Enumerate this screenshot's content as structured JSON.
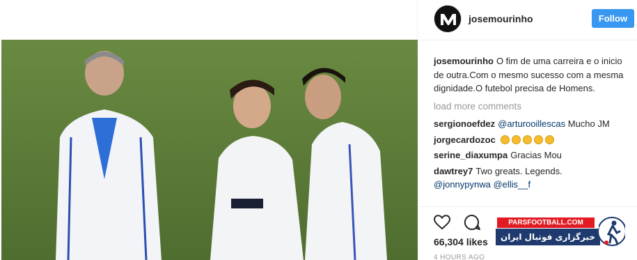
{
  "post": {
    "username": "josemourinho",
    "follow_label": "Follow",
    "caption_username": "josemourinho",
    "caption_text": "O fim de uma carreira e o inicio de outra.Com o mesmo sucesso com a mesma dignidade.O futebol precisa de Homens.",
    "load_more": "load more comments",
    "comments": [
      {
        "user": "sergionoefdez",
        "mention": "@arturooillescas",
        "text": " Mucho JM"
      },
      {
        "user": "jorgecardozoc",
        "emoji_count": 5
      },
      {
        "user": "serine_diaxumpa",
        "text": "Gracias Mou"
      },
      {
        "user": "dawtrey7",
        "text": "Two greats. Legends.",
        "mentions_line": "@jonnypynwa @ellis__f"
      }
    ],
    "likes": "66,304 likes",
    "time": "4 HOURS AGO"
  },
  "icons": {
    "heart": "heart-icon",
    "comment": "comment-icon",
    "avatar": "avatar-logo"
  },
  "watermark": {
    "top": "PARSFOOTBALL.COM",
    "bottom": "خبرگزاری فوتبال ایران"
  },
  "colors": {
    "follow_bg": "#3897f0",
    "mention": "#003569",
    "muted": "#999999",
    "watermark_red": "#e21b22",
    "watermark_blue": "#1e3a6e"
  }
}
